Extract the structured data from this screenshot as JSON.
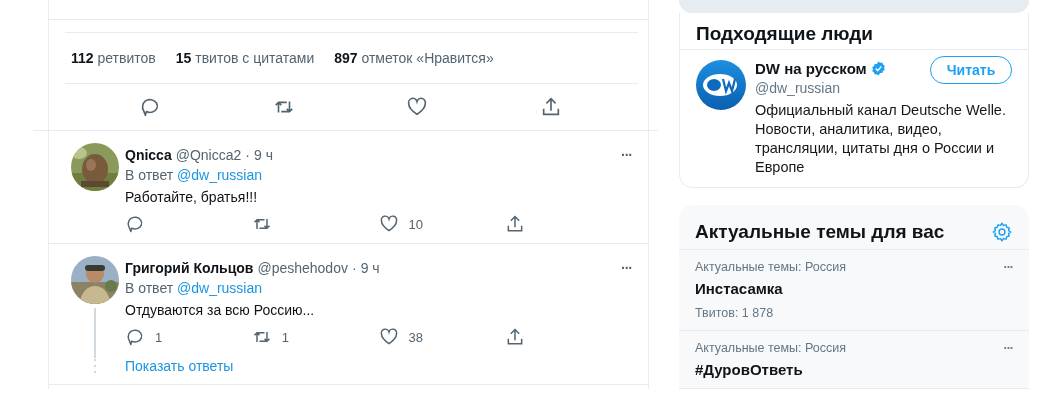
{
  "main_tweet": {
    "stats": [
      {
        "count": "112",
        "label": "ретвитов"
      },
      {
        "count": "15",
        "label": "твитов с цитатами"
      },
      {
        "count": "897",
        "label": "отметок «Нравится»"
      }
    ]
  },
  "replies": [
    {
      "name": "Qnicca",
      "handle": "@Qnicca2",
      "separator": "·",
      "time": "9 ч",
      "reply_prefix": "В ответ",
      "reply_to": "@dw_russian",
      "text": "Работайте, братья!!!",
      "actions": [
        {
          "kind": "reply"
        },
        {
          "kind": "retweet"
        },
        {
          "kind": "like",
          "count": "10"
        },
        {
          "kind": "share"
        }
      ],
      "more": "···"
    },
    {
      "name": "Григорий Кольцов",
      "handle": "@peshehodov",
      "separator": "·",
      "time": "9 ч",
      "reply_prefix": "В ответ",
      "reply_to": "@dw_russian",
      "text": "Отдуваются за всю Россию...",
      "actions": [
        {
          "kind": "reply",
          "count": "1"
        },
        {
          "kind": "retweet",
          "count": "1"
        },
        {
          "kind": "like",
          "count": "38"
        },
        {
          "kind": "share"
        }
      ],
      "more": "···",
      "show_replies": "Показать ответы"
    }
  ],
  "who_to_follow": {
    "title": "Подходящие люди",
    "users": [
      {
        "name": "DW на русском",
        "verified": true,
        "handle": "@dw_russian",
        "button": "Читать",
        "bio": "Официальный канал Deutsche Welle. Новости, аналитика, видео, трансляции, цитаты дня о России и Европе"
      }
    ]
  },
  "trends": {
    "title": "Актуальные темы для вас",
    "items": [
      {
        "context": "Актуальные темы: Россия",
        "name": "Инстасамка",
        "count": "Твитов: 1 878",
        "more": "···"
      },
      {
        "context": "Актуальные темы: Россия",
        "name": "#ДуровОтветь",
        "more": "···"
      }
    ]
  }
}
